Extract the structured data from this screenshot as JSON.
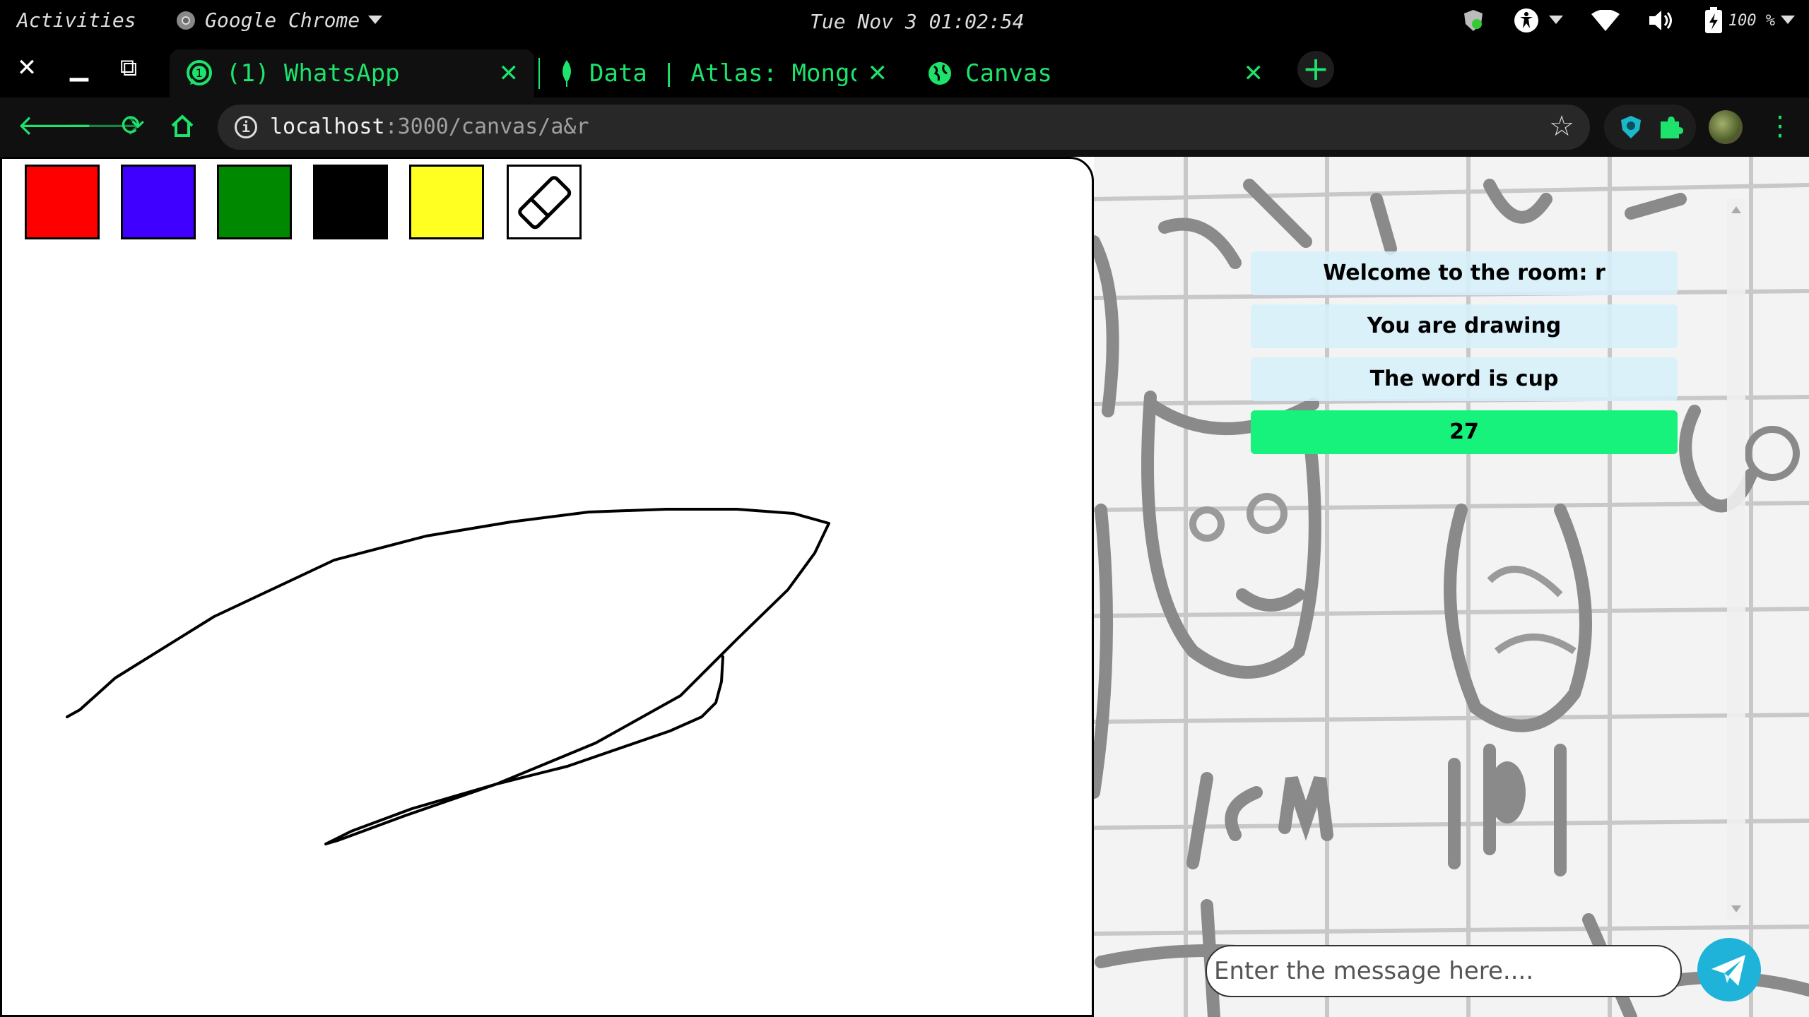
{
  "topbar": {
    "activities": "Activities",
    "app_name": "Google Chrome",
    "clock": "Tue Nov 3  01:02:54",
    "battery": "100 %"
  },
  "tabs": [
    {
      "title": "(1) WhatsApp",
      "icon": "whatsapp-icon",
      "badge": "1"
    },
    {
      "title": "Data | Atlas: MongoDB",
      "icon": "mongodb-leaf-icon"
    },
    {
      "title": "Canvas",
      "icon": "globe-icon"
    }
  ],
  "omnibox": {
    "host": "localhost",
    "path": ":3000/canvas/a&r"
  },
  "palette": [
    {
      "name": "red",
      "color": "#ff0000"
    },
    {
      "name": "blue",
      "color": "#3f00ff"
    },
    {
      "name": "green",
      "color": "#008800"
    },
    {
      "name": "black",
      "color": "#000000"
    },
    {
      "name": "yellow",
      "color": "#ffff22"
    }
  ],
  "chat": {
    "messages": [
      "Welcome to the room: r",
      "You are drawing",
      "The word is cup"
    ],
    "timer": "27",
    "input_placeholder": "Enter the message here...."
  },
  "colors": {
    "accent": "#1de36c",
    "timer_bg": "#17f27d",
    "message_bg": "#d7f0fa",
    "send_button": "#1fb3da"
  }
}
